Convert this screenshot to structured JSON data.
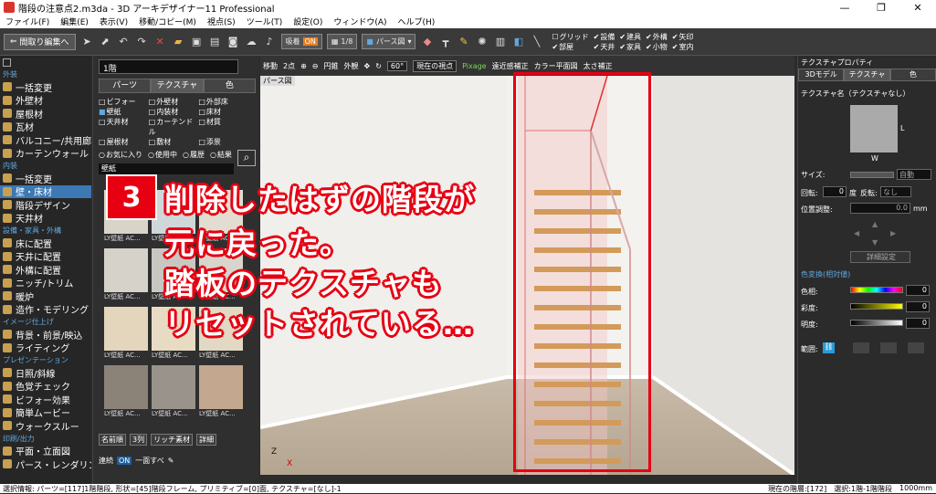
{
  "window": {
    "title": "階段の注意点2.m3da - 3D アーキデザイナー11 Professional",
    "controls": [
      "—",
      "❐",
      "✕"
    ]
  },
  "menu": [
    "ファイル(F)",
    "編集(E)",
    "表示(V)",
    "移動/コピー(M)",
    "視点(S)",
    "ツール(T)",
    "設定(O)",
    "ウィンドウ(A)",
    "ヘルプ(H)"
  ],
  "toolbar": {
    "back_label": "間取り編集へ",
    "pill1": "吸着",
    "pill1_state": "ON",
    "pill2": "1/8",
    "pill3": "パース図",
    "checks": [
      {
        "label": "グリッド",
        "on": false
      },
      {
        "label": "設備",
        "on": true
      },
      {
        "label": "建具",
        "on": true
      },
      {
        "label": "外構",
        "on": true
      },
      {
        "label": "矢印",
        "on": true
      },
      {
        "label": "部屋",
        "on": true
      },
      {
        "label": "天井",
        "on": true
      },
      {
        "label": "家具",
        "on": true
      },
      {
        "label": "小物",
        "on": true
      },
      {
        "label": "室内",
        "on": true
      }
    ]
  },
  "leftnav": {
    "sections": [
      {
        "title": "外装",
        "items": [
          "一括変更",
          "外壁材",
          "屋根材",
          "瓦材",
          "バルコニー/共用廊下",
          "カーテンウォール"
        ]
      },
      {
        "title": "内装",
        "items": [
          "一括変更",
          "壁・床材",
          "階段デザイン",
          "天井材"
        ]
      },
      {
        "title": "設備・家具・外構",
        "items": [
          "床に配置",
          "天井に配置",
          "外構に配置",
          "ニッチ/トリム",
          "暖炉",
          "造作・モデリング"
        ]
      },
      {
        "title": "イメージ仕上げ",
        "items": [
          "背景・前景/映込",
          "ライティング"
        ]
      },
      {
        "title": "プレゼンテーション",
        "items": [
          "日照/斜線",
          "色覚チェック",
          "ビフォー効果",
          "簡単ムービー",
          "ウォークスルー"
        ]
      },
      {
        "title": "印刷/出力",
        "items": [
          "平面・立面図",
          "パース・レンダリング"
        ]
      }
    ],
    "selected": "壁・床材"
  },
  "material_panel": {
    "floor": "1階",
    "tabs": [
      "パーツ",
      "テクスチャ",
      "色"
    ],
    "active_tab": "テクスチャ",
    "categories": [
      "ビフォー",
      "外壁材",
      "外部床",
      "壁紙",
      "内装材",
      "床材",
      "天井材",
      "カーテンドル",
      "材質",
      "屋根材",
      "敷材",
      "添景"
    ],
    "selected_category": "壁紙",
    "filters": [
      "お気に入り",
      "使用中",
      "履歴",
      "結果"
    ],
    "path": "壁紙",
    "textures": [
      {
        "label": "LY壁紙 AC...",
        "color": "#d9d4c8"
      },
      {
        "label": "LY壁紙 AC...",
        "color": "#cfd7d8"
      },
      {
        "label": "LY壁紙 AC...",
        "color": "#e2ddd0"
      },
      {
        "label": "LY壁紙 AC...",
        "color": "#d6d2c9"
      },
      {
        "label": "LY壁紙 AC...",
        "color": "#c8c7c2"
      },
      {
        "label": "LY壁紙 AC...",
        "color": "#d8d5cd"
      },
      {
        "label": "LY壁紙 AC...",
        "color": "#e3d6bd"
      },
      {
        "label": "LY壁紙 AC...",
        "color": "#e7dcc3"
      },
      {
        "label": "LY壁紙 AC...",
        "color": "#e2d9c4"
      },
      {
        "label": "LY壁紙 AC...",
        "color": "#8c8378"
      },
      {
        "label": "LY壁紙 AC...",
        "color": "#9a938b"
      },
      {
        "label": "LY壁紙 AC...",
        "color": "#c3a88f"
      }
    ],
    "sort": "名前順",
    "columns": "3列",
    "rich_label": "リッチ素材",
    "detail_label": "詳細",
    "continuous": "連続",
    "continuous_state": "ON",
    "apply_all": "一面すべ"
  },
  "viewport": {
    "toolbar": [
      "移動",
      "2点",
      "円錐",
      "外観",
      "60°",
      "現在の視点",
      "Pixage",
      "遠近感補正",
      "カラー平面図",
      "太さ補正"
    ],
    "view_label": "パース図",
    "axis_z": "Z",
    "axis_x": "X"
  },
  "annotation": {
    "number": "3",
    "lines": [
      "削除したはずの階段が",
      "元に戻った。",
      "踏板のテクスチャも",
      "リセットされている…"
    ],
    "color": "#e60012"
  },
  "right_panel": {
    "title": "テクスチャプロパティ",
    "tabs": [
      "3Dモデル",
      "テクスチャ",
      "色"
    ],
    "texture_name": "テクスチャ名（テクスチャなし）",
    "w_label": "W",
    "l_label": "L",
    "size_label": "サイズ:",
    "size_value": "自動",
    "rotate_label": "回転:",
    "rotate_value": "0",
    "rotate_unit": "度",
    "flip_label": "反転:",
    "flip_value": "なし",
    "position_label": "位置調整:",
    "position_value": "0.0",
    "position_unit": "mm",
    "detail_button": "詳細設定",
    "color_section": "色変換(相対値)",
    "hue_label": "色相:",
    "hue_value": "0",
    "sat_label": "彩度:",
    "sat_value": "0",
    "bright_label": "明度:",
    "bright_value": "0",
    "range_label": "範囲:"
  },
  "status": {
    "left": "選択情報: パーツ=[117]1階階段, 形状=[45]階段フレーム, プリミティブ=[0]面, テクスチャ=[なし]-1",
    "floor": "現在の階層:[172]",
    "selection": "選択:1階-1階階段",
    "grid": "1000mm"
  }
}
